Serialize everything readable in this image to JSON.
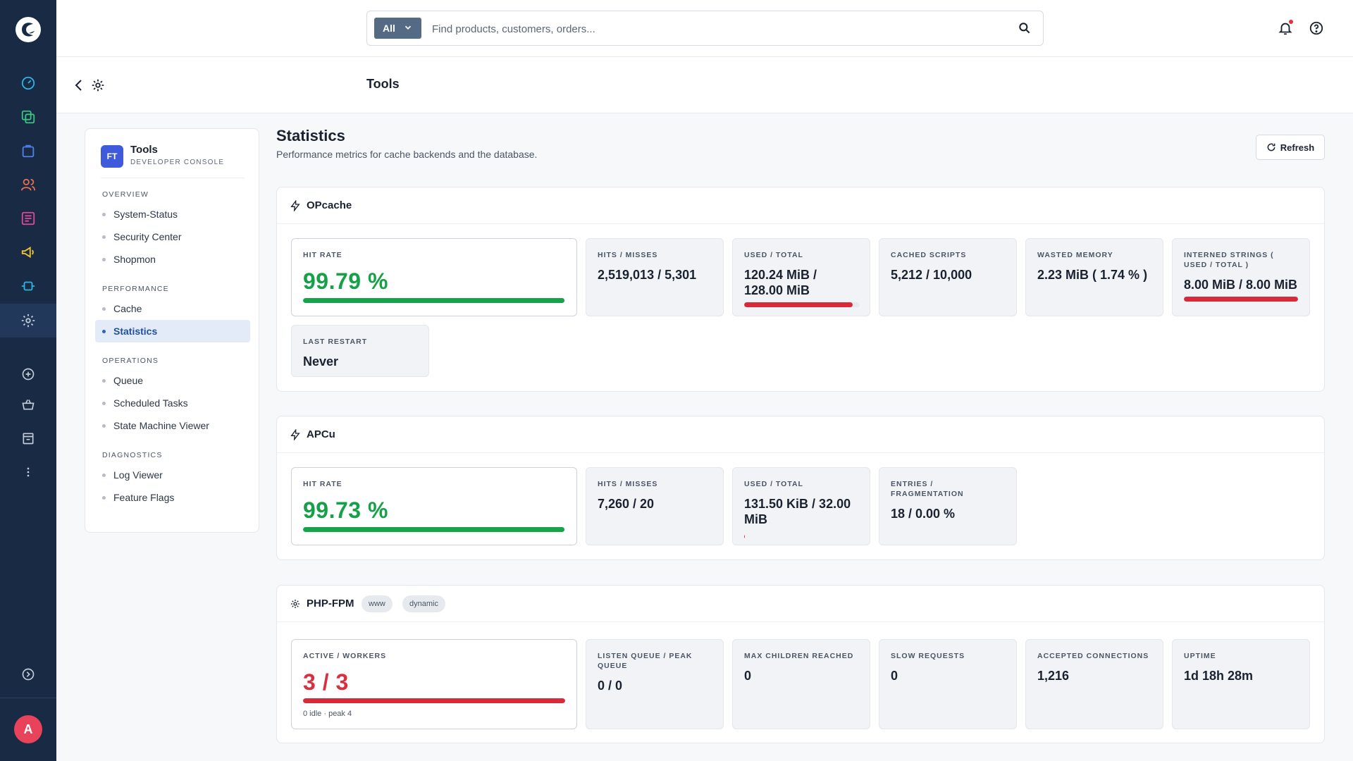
{
  "rail": {
    "icons": [
      "brand-logo-icon",
      "dashboard-icon",
      "catalog-icon",
      "orders-icon",
      "customers-icon",
      "content-icon",
      "marketing-icon",
      "extensions-icon",
      "settings-icon",
      "add-icon",
      "sales-channel-icon",
      "store-icon",
      "more-icon",
      "expand-icon"
    ],
    "avatar_initial": "A",
    "accent": "#182a44"
  },
  "topbar": {
    "scope_label": "All",
    "search_placeholder": "Find products, customers, orders...",
    "notification_dot_color": "#e52d3e"
  },
  "header": {
    "title": "Tools"
  },
  "nav": {
    "badge": "FT",
    "title": "Tools",
    "subtitle": "DEVELOPER CONSOLE",
    "sections": [
      {
        "title": "OVERVIEW",
        "items": [
          "System-Status",
          "Security Center",
          "Shopmon"
        ]
      },
      {
        "title": "PERFORMANCE",
        "items": [
          "Cache",
          "Statistics"
        ]
      },
      {
        "title": "OPERATIONS",
        "items": [
          "Queue",
          "Scheduled Tasks",
          "State Machine Viewer"
        ]
      },
      {
        "title": "DIAGNOSTICS",
        "items": [
          "Log Viewer",
          "Feature Flags"
        ]
      }
    ],
    "active_item": "Statistics"
  },
  "page": {
    "title": "Statistics",
    "subtitle": "Performance metrics for cache backends and the database.",
    "refresh_label": "Refresh"
  },
  "opcache": {
    "title": "OPcache",
    "hit_rate_label": "HIT RATE",
    "hit_rate": "99.79 %",
    "hit_rate_pct": 99.79,
    "hits_label": "HITS / MISSES",
    "hits": "2,519,013 / 5,301",
    "used_label": "USED / TOTAL",
    "used": "120.24 MiB / 128.00 MiB",
    "used_pct": 93.9,
    "scripts_label": "CACHED SCRIPTS",
    "scripts": "5,212 / 10,000",
    "wasted_label": "WASTED MEMORY",
    "wasted": "2.23 MiB ( 1.74 % )",
    "interned_label": "INTERNED STRINGS ( USED / TOTAL )",
    "interned": "8.00 MiB / 8.00 MiB",
    "interned_pct": 100,
    "restart_label": "LAST RESTART",
    "restart": "Never"
  },
  "apcu": {
    "title": "APCu",
    "hit_rate_label": "HIT RATE",
    "hit_rate": "99.73 %",
    "hit_rate_pct": 99.73,
    "hits_label": "HITS / MISSES",
    "hits": "7,260 / 20",
    "used_label": "USED / TOTAL",
    "used": "131.50 KiB / 32.00 MiB",
    "used_pct": 0.4,
    "entries_label": "ENTRIES / FRAGMENTATION",
    "entries": "18 / 0.00 %"
  },
  "fpm": {
    "title": "PHP-FPM",
    "badges": [
      "www",
      "dynamic"
    ],
    "active_label": "ACTIVE / WORKERS",
    "active": "3 / 3",
    "active_pct": 100,
    "active_note": "0 idle · peak 4",
    "queue_label": "LISTEN QUEUE / PEAK QUEUE",
    "queue": "0 / 0",
    "maxchildren_label": "MAX CHILDREN REACHED",
    "maxchildren": "0",
    "slow_label": "SLOW REQUESTS",
    "slow": "0",
    "accepted_label": "ACCEPTED CONNECTIONS",
    "accepted": "1,216",
    "uptime_label": "UPTIME",
    "uptime": "1d 18h 28m"
  }
}
